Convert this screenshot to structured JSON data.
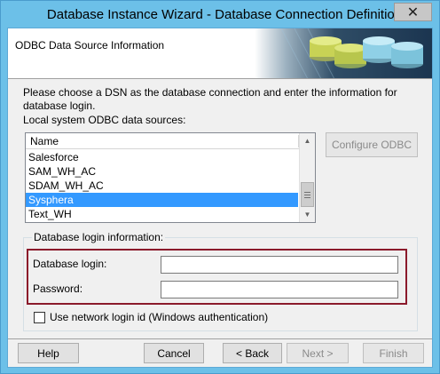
{
  "window": {
    "title": "Database Instance Wizard - Database Connection Definition",
    "close_glyph": "✕"
  },
  "header": {
    "title": "ODBC Data Source Information",
    "art_icon": "database-cylinders-icon"
  },
  "instructions": "Please choose a DSN as the database connection and enter the information for database login.",
  "sources_label": "Local system ODBC data sources:",
  "sources_list": {
    "column_header": "Name",
    "items": [
      "Salesforce",
      "SAM_WH_AC",
      "SDAM_WH_AC",
      "Sysphera",
      "Text_WH"
    ],
    "selected": "Sysphera"
  },
  "configure_button": "Configure ODBC",
  "login_group": {
    "label": "Database login information:",
    "login_label": "Database login:",
    "login_value": "",
    "password_label": "Password:",
    "password_value": "",
    "network_login_label": "Use network login id (Windows authentication)",
    "network_login_checked": false
  },
  "buttons": {
    "help": "Help",
    "cancel": "Cancel",
    "back": "< Back",
    "next": "Next >",
    "finish": "Finish"
  },
  "colors": {
    "title_bar": "#6cc0e8",
    "selection": "#3399ff",
    "highlight_box": "#8b1a2b"
  }
}
